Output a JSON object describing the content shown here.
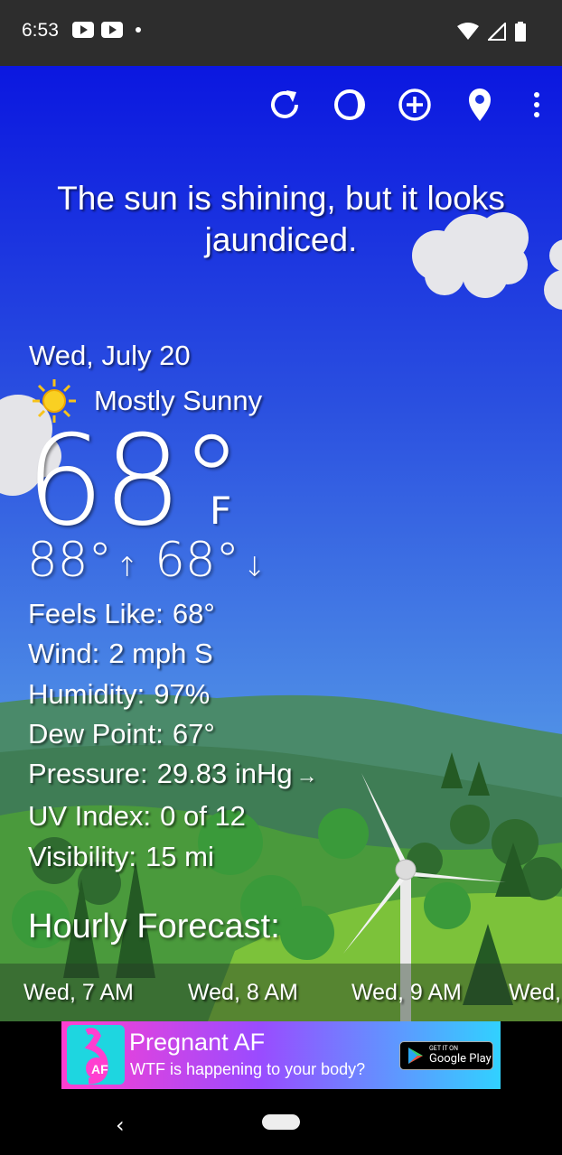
{
  "status_bar": {
    "time": "6:53"
  },
  "toolbar": {
    "icons": [
      "refresh-icon",
      "theme-icon",
      "add-icon",
      "location-icon",
      "more-vert-icon"
    ]
  },
  "headline": "The sun is shining, but it looks jaundiced.",
  "current": {
    "date": "Wed, July 20",
    "condition": "Mostly Sunny",
    "temperature": "68°",
    "unit": "F",
    "high": "88°",
    "high_arrow": "↑",
    "low": "68°",
    "low_arrow": "↓"
  },
  "details": [
    {
      "label": "Feels Like:",
      "value": "68°"
    },
    {
      "label": "Wind:",
      "value": "2 mph S"
    },
    {
      "label": "Humidity:",
      "value": "97%"
    },
    {
      "label": "Dew Point:",
      "value": "67°"
    },
    {
      "label": "Pressure:",
      "value": "29.83 inHg"
    },
    {
      "label": "UV Index:",
      "value": "0 of 12"
    },
    {
      "label": "Visibility:",
      "value": "15 mi"
    }
  ],
  "pressure_arrow": "→",
  "hourly": {
    "title": "Hourly Forecast:",
    "items": [
      "Wed, 7 AM",
      "Wed, 8 AM",
      "Wed, 9 AM",
      "Wed,"
    ]
  },
  "ad": {
    "title": "Pregnant AF",
    "subtitle": "WTF is happening to your body?",
    "logo_text": "AF",
    "badge_small": "GET IT ON",
    "badge_large": "Google Play"
  },
  "nav": {
    "back_glyph": "‹"
  }
}
